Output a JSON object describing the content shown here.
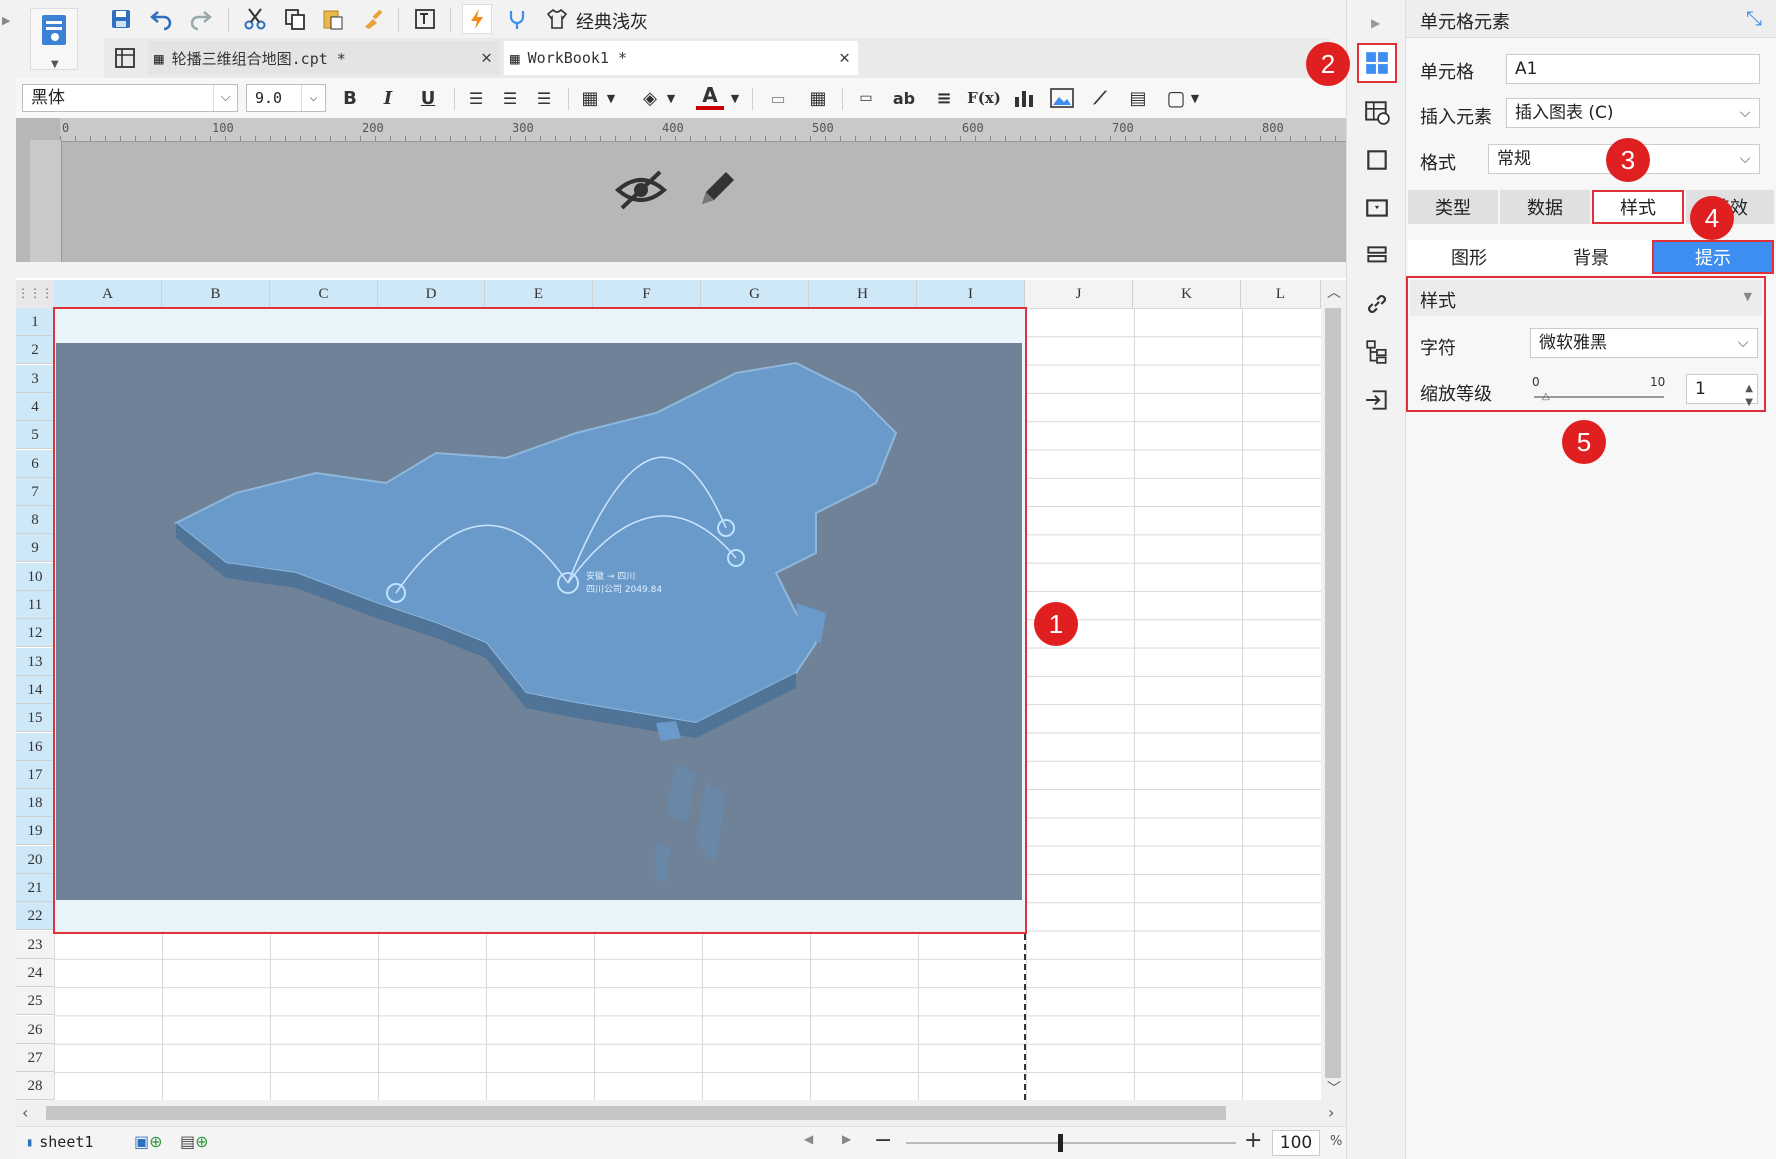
{
  "toolbar": {
    "theme_label": "经典浅灰"
  },
  "tabs": [
    {
      "label": "轮播三维组合地图.cpt *"
    },
    {
      "label": "WorkBook1 *"
    }
  ],
  "format": {
    "font": "黑体",
    "size": "9.0",
    "bold": "B",
    "italic": "I",
    "underline": "U",
    "fx": "F(x)",
    "ab": "ab"
  },
  "ruler": {
    "ticks": [
      "0",
      "100",
      "200",
      "300",
      "400",
      "500",
      "600",
      "700",
      "800"
    ]
  },
  "grid": {
    "columns": [
      "A",
      "B",
      "C",
      "D",
      "E",
      "F",
      "G",
      "H",
      "I",
      "J",
      "K",
      "L"
    ],
    "rows": [
      "1",
      "2",
      "3",
      "4",
      "5",
      "6",
      "7",
      "8",
      "9",
      "10",
      "11",
      "12",
      "13",
      "14",
      "15",
      "16",
      "17",
      "18",
      "19",
      "20",
      "21",
      "22",
      "23",
      "24",
      "25",
      "26",
      "27",
      "28"
    ]
  },
  "map": {
    "label_line1": "安徽 → 四川",
    "label_line2": "四川公司 2049.84"
  },
  "status": {
    "sheet": "sheet1",
    "zoom": "100",
    "zoom_unit": "%"
  },
  "panel": {
    "title": "单元格元素",
    "cell_label": "单元格",
    "cell_value": "A1",
    "insert_label": "插入元素",
    "insert_value": "插入图表 (C)",
    "format_label": "格式",
    "format_value": "常规",
    "tabs": [
      "类型",
      "数据",
      "样式",
      "特效"
    ],
    "subtabs": [
      "图形",
      "背景",
      "提示"
    ],
    "style_header": "样式",
    "font_label": "字符",
    "font_value": "微软雅黑",
    "zoom_label": "缩放等级",
    "zoom_min": "0",
    "zoom_max": "10",
    "zoom_value": "1"
  },
  "badges": [
    "1",
    "2",
    "3",
    "4",
    "5"
  ],
  "colors": {
    "accent": "#3d8ef0",
    "highlight": "#e02020",
    "selected_tab": "#3d8ef0",
    "map_bg": "#6f8297",
    "map_land": "#6a9ac9"
  }
}
